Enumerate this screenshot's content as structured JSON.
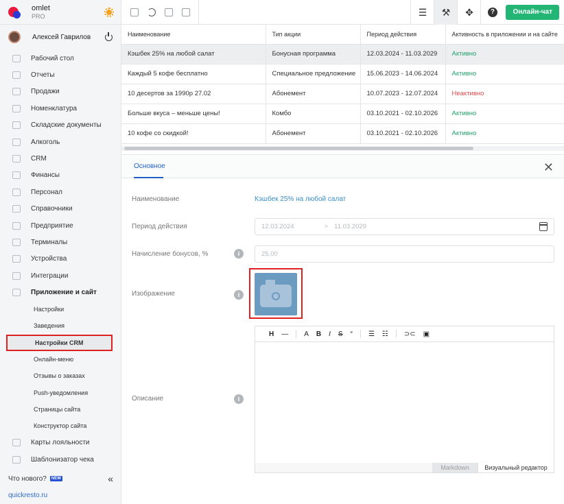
{
  "brand": {
    "name": "omlet",
    "plan": "PRO"
  },
  "user": {
    "name": "Алексей Гаврилов"
  },
  "nav": [
    {
      "label": "Рабочий стол",
      "icon": "dashboard-icon"
    },
    {
      "label": "Отчеты",
      "icon": "chart-icon"
    },
    {
      "label": "Продажи",
      "icon": "basket-icon"
    },
    {
      "label": "Номенклатура",
      "icon": "tag-icon"
    },
    {
      "label": "Складские документы",
      "icon": "box-icon"
    },
    {
      "label": "Алкоголь",
      "icon": "glass-icon"
    },
    {
      "label": "CRM",
      "icon": "users-icon"
    },
    {
      "label": "Финансы",
      "icon": "wallet-icon"
    },
    {
      "label": "Персонал",
      "icon": "people-icon"
    },
    {
      "label": "Справочники",
      "icon": "book-icon"
    },
    {
      "label": "Предприятие",
      "icon": "building-icon"
    },
    {
      "label": "Терминалы",
      "icon": "terminal-icon"
    },
    {
      "label": "Устройства",
      "icon": "printer-icon"
    },
    {
      "label": "Интеграции",
      "icon": "link-icon"
    },
    {
      "label": "Приложение и сайт",
      "icon": "monitor-icon"
    }
  ],
  "subnav": [
    "Настройки",
    "Заведения",
    "Настройки CRM",
    "Онлайн-меню",
    "Отзывы о заказах",
    "Push-уведомления",
    "Страницы сайта",
    "Конструктор сайта"
  ],
  "nav_bottom": [
    {
      "label": "Карты лояльности",
      "icon": "card-icon"
    },
    {
      "label": "Шаблонизатор чека",
      "icon": "receipt-icon"
    }
  ],
  "whats_new": {
    "label": "Что нового?",
    "badge": "NEW"
  },
  "site_link": "quickresto.ru",
  "toolbar": {
    "chat_label": "Онлайн-чат",
    "help": "?"
  },
  "table": {
    "headers": [
      "Наименование",
      "Тип акции",
      "Период действия",
      "Активность в приложении и на сайте"
    ],
    "rows": [
      {
        "name": "Кэшбек 25% на любой салат",
        "type": "Бонусная программа",
        "period": "12.03.2024 - 11.03.2029",
        "status": "Активно"
      },
      {
        "name": "Каждый 5 кофе бесплатно",
        "type": "Специальное предложение",
        "period": "15.06.2023 - 14.06.2024",
        "status": "Активно"
      },
      {
        "name": "10 десертов за 1990р 27.02",
        "type": "Абонемент",
        "period": "10.07.2023 - 12.07.2024",
        "status": "Неактивно"
      },
      {
        "name": "Больше вкуса – меньше цены!",
        "type": "Комбо",
        "period": "03.10.2021 - 02.10.2026",
        "status": "Активно"
      },
      {
        "name": "10 кофе со скидкой!",
        "type": "Абонемент",
        "period": "03.10.2021 - 02.10.2026",
        "status": "Активно"
      }
    ]
  },
  "detail": {
    "tab": "Основное",
    "labels": {
      "name": "Наименование",
      "period": "Период действия",
      "bonus": "Начисление бонусов, %",
      "image": "Изображение",
      "description": "Описание"
    },
    "name_value": "Кэшбек 25% на любой салат",
    "period_from": "12.03.2024",
    "period_to": "11.03.2029",
    "period_sep": ">",
    "bonus_value": "25,00",
    "info": "i",
    "editor": {
      "tools": [
        "H",
        "—",
        "A",
        "B",
        "I",
        "S",
        "“",
        "list",
        "olist",
        "link",
        "image"
      ],
      "markdown_label": "Markdown",
      "visual_label": "Визуальный редактор"
    }
  },
  "colors": {
    "accent": "#1f5fc8",
    "active": "#22a06b",
    "inactive": "#e04848",
    "chat": "#23b574",
    "highlight": "#e02020"
  }
}
